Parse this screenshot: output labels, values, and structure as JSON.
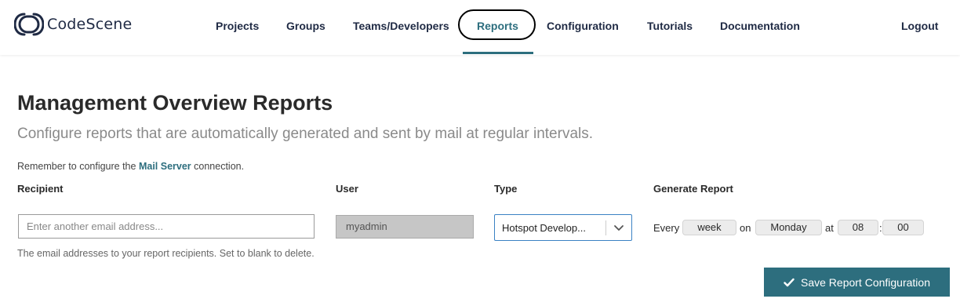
{
  "app": {
    "name": "CodeScene"
  },
  "nav": {
    "items": [
      {
        "label": "Projects"
      },
      {
        "label": "Groups"
      },
      {
        "label": "Teams/Developers"
      },
      {
        "label": "Reports"
      },
      {
        "label": "Configuration"
      },
      {
        "label": "Tutorials"
      },
      {
        "label": "Documentation"
      }
    ],
    "active": "Reports",
    "logout": "Logout"
  },
  "page": {
    "title": "Management Overview Reports",
    "subtitle": "Configure reports that are automatically generated and sent by mail at regular intervals.",
    "reminder_prefix": "Remember to configure the",
    "reminder_link": "Mail Server",
    "reminder_suffix": "connection."
  },
  "form": {
    "columns": {
      "recipient": "Recipient",
      "user": "User",
      "type": "Type",
      "generate": "Generate Report"
    },
    "recipient": {
      "placeholder": "Enter another email address...",
      "value": "",
      "help": "The email addresses to your report recipients. Set to blank to delete."
    },
    "user": {
      "value": "myadmin"
    },
    "type": {
      "selected": "Hotspot Develop..."
    },
    "schedule": {
      "every_label": "Every",
      "interval": "week",
      "on_label": "on",
      "day": "Monday",
      "at_label": "at",
      "hour": "08",
      "colon": ":",
      "minute": "00"
    },
    "save_label": "Save Report Configuration"
  },
  "colors": {
    "accent": "#2d6e7e",
    "nav_text": "#1f2a44",
    "select_border": "#3b82c4"
  },
  "icons": {
    "logo": "codescene-logo-icon",
    "select": "chevron-down-icon",
    "save": "checkmark-icon"
  }
}
